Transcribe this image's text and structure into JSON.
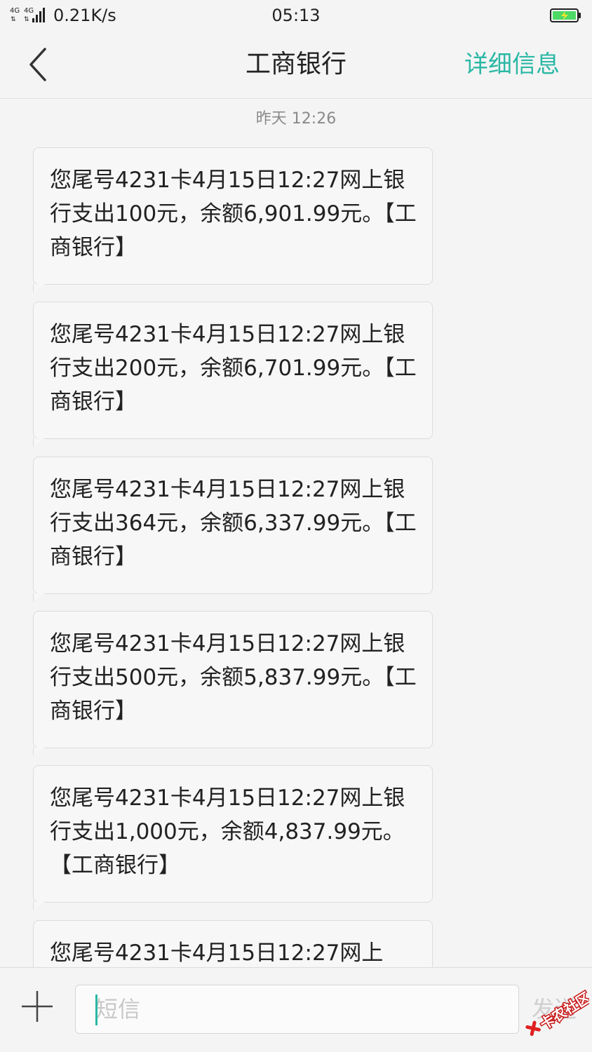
{
  "status_bar": {
    "network": "4G 4G",
    "speed": "0.21K/s",
    "time": "05:13"
  },
  "header": {
    "back_icon": "chevron-left-icon",
    "title": "工商银行",
    "detail_label": "详细信息",
    "accent_color": "#2bb8a5"
  },
  "conversation": {
    "timestamp": "昨天 12:26",
    "messages": [
      {
        "text": "您尾号4231卡4月15日12:27网上银行支出100元，余额6,901.99元。【工商银行】"
      },
      {
        "text": "您尾号4231卡4月15日12:27网上银行支出200元，余额6,701.99元。【工商银行】"
      },
      {
        "text": "您尾号4231卡4月15日12:27网上银行支出364元，余额6,337.99元。【工商银行】"
      },
      {
        "text": "您尾号4231卡4月15日12:27网上银行支出500元，余额5,837.99元。【工商银行】"
      },
      {
        "text": "您尾号4231卡4月15日12:27网上银行支出1,000元，余额4,837.99元。【工商银行】"
      },
      {
        "text": "您尾号4231卡4月15日12:27网上"
      }
    ]
  },
  "composer": {
    "add_icon": "plus-icon",
    "placeholder": "短信",
    "send_label": "发送"
  },
  "watermark": {
    "text": "卡农社区"
  }
}
